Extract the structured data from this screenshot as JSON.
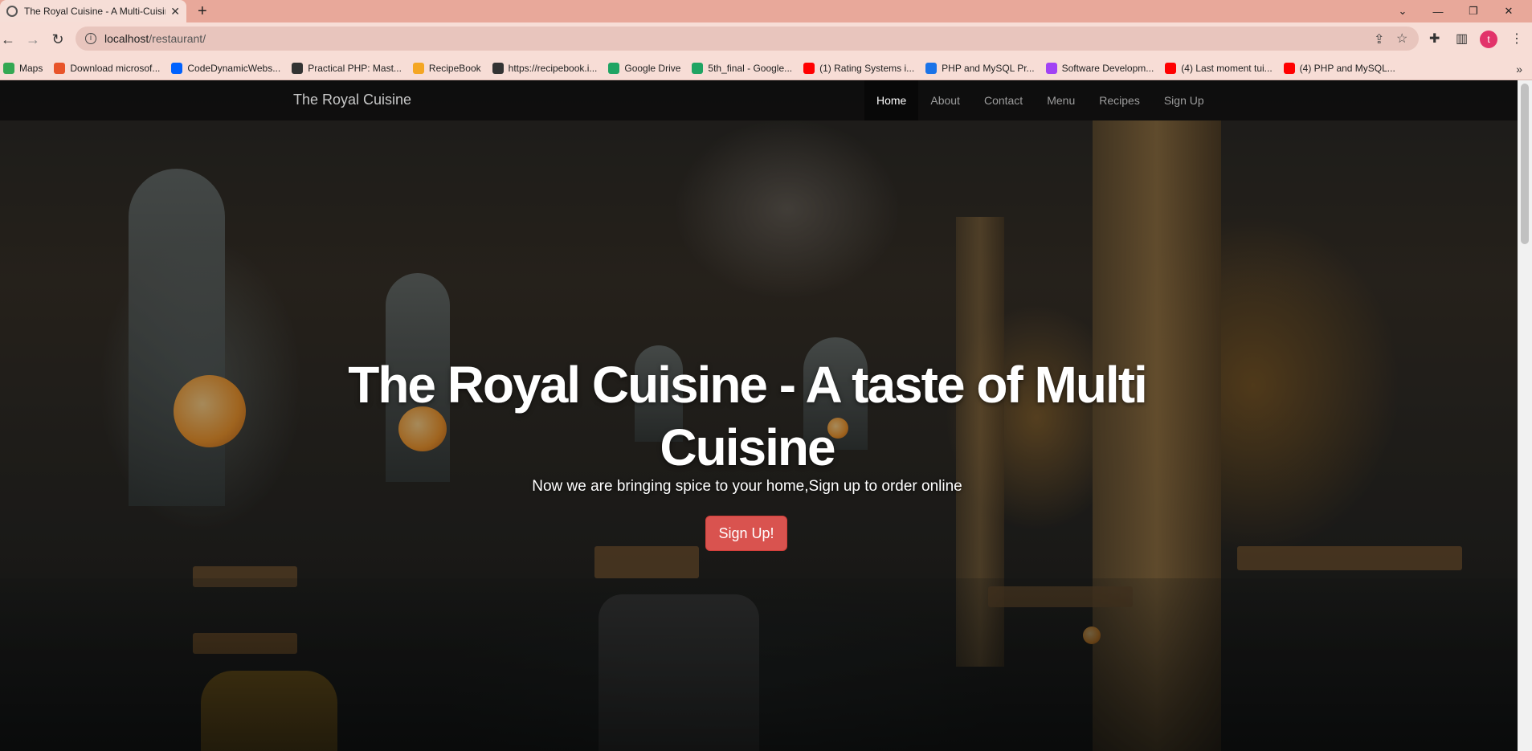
{
  "browser": {
    "tab_title": "The Royal Cuisine - A Multi-Cuisine",
    "new_tab_icon": "plus-icon",
    "url_host": "localhost",
    "url_path": "/restaurant/",
    "profile_initial": "t",
    "bookmarks": [
      {
        "label": "Maps",
        "icon": "maps-icon",
        "color": "#34a853"
      },
      {
        "label": "Download microsof...",
        "icon": "x-icon",
        "color": "#e8542a"
      },
      {
        "label": "CodeDynamicWebs...",
        "icon": "dropbox-icon",
        "color": "#0061fe"
      },
      {
        "label": "Practical PHP: Mast...",
        "icon": "globe-icon",
        "color": "#333333"
      },
      {
        "label": "RecipeBook",
        "icon": "recipe-icon",
        "color": "#f4a623"
      },
      {
        "label": "https://recipebook.i...",
        "icon": "globe-icon",
        "color": "#333333"
      },
      {
        "label": "Google Drive",
        "icon": "drive-icon",
        "color": "#1fa463"
      },
      {
        "label": "5th_final - Google...",
        "icon": "drive-icon",
        "color": "#1fa463"
      },
      {
        "label": "(1) Rating Systems i...",
        "icon": "youtube-icon",
        "color": "#ff0000"
      },
      {
        "label": "PHP and MySQL Pr...",
        "icon": "f-icon",
        "color": "#1a73e8"
      },
      {
        "label": "Software Developm...",
        "icon": "purple-circle-icon",
        "color": "#a142f4"
      },
      {
        "label": "(4) Last moment tui...",
        "icon": "youtube-icon",
        "color": "#ff0000"
      },
      {
        "label": "(4) PHP and MySQL...",
        "icon": "youtube-icon",
        "color": "#ff0000"
      }
    ]
  },
  "site": {
    "brand": "The Royal Cuisine",
    "nav": [
      {
        "label": "Home",
        "active": true
      },
      {
        "label": "About",
        "active": false
      },
      {
        "label": "Contact",
        "active": false
      },
      {
        "label": "Menu",
        "active": false
      },
      {
        "label": "Recipes",
        "active": false
      },
      {
        "label": "Sign Up",
        "active": false
      }
    ],
    "hero": {
      "title": "The Royal Cuisine - A taste of Multi Cuisine",
      "subtitle": "Now we are bringing spice to your home,Sign up to order online",
      "button": "Sign Up!"
    }
  }
}
